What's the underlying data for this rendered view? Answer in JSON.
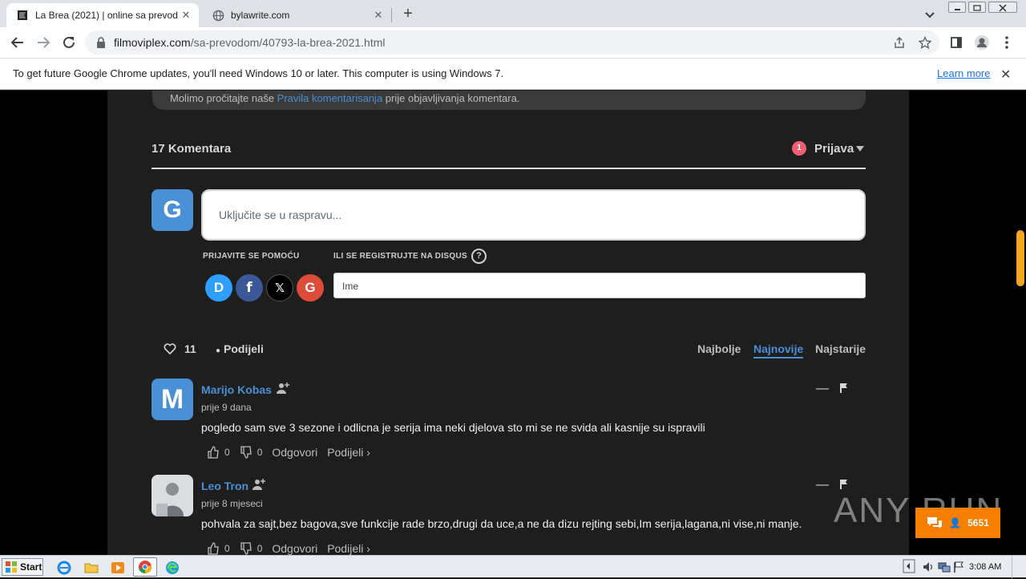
{
  "browser": {
    "tabs": [
      {
        "title": "La Brea (2021) | online sa prevodom",
        "active": true
      },
      {
        "title": "bylawrite.com",
        "active": false
      }
    ],
    "url_domain": "filmoviplex.com",
    "url_path": "/sa-prevodom/40793-la-brea-2021.html",
    "infobar_message": "To get future Google Chrome updates, you'll need Windows 10 or later. This computer is using Windows 7.",
    "infobar_link": "Learn more"
  },
  "page": {
    "rules_text_before": "Molimo pročitajte naše ",
    "rules_link": "Pravila komentarisanja",
    "rules_text_after": " prije objavljivanja komentara.",
    "comment_count": "17 Komentara",
    "notification_count": "1",
    "login_label": "Prijava",
    "guest_avatar_letter": "G",
    "reply_placeholder": "Uključite se u raspravu...",
    "login_with_label": "PRIJAVITE SE POMOĆU",
    "register_label": "ILI SE REGISTRUJTE NA DISQUS",
    "help_glyph": "?",
    "name_placeholder": "Ime",
    "social": [
      {
        "name": "disqus",
        "letter": "D",
        "color": "#2e9fff"
      },
      {
        "name": "facebook",
        "letter": "f",
        "color": "#3b5998"
      },
      {
        "name": "x",
        "letter": "𝕏",
        "color": "#000000"
      },
      {
        "name": "google",
        "letter": "G",
        "color": "#dd4b39"
      }
    ],
    "votes_count": "11",
    "share_label": "Podijeli",
    "sort_options": [
      "Najbolje",
      "Najnovije",
      "Najstarije"
    ],
    "active_sort": "Najnovije"
  },
  "comments": [
    {
      "author": "Marijo Kobas",
      "avatar_letter": "M",
      "time": "prije 9 dana",
      "text": "pogledo sam sve 3 sezone i odlicna je serija ima neki djelova sto mi se ne svida ali kasnije su ispravili",
      "upvotes": "0",
      "downvotes": "0",
      "reply_label": "Odgovori",
      "share_label": "Podijeli ›"
    },
    {
      "author": "Leo Tron",
      "avatar_letter": "",
      "time": "prije 8 mjeseci",
      "text": "pohvala za sajt,bez bagova,sve funkcije rade brzo,drugi da uce,a ne da dizu rejting sebi,Im serija,lagana,ni vise,ni manje.",
      "upvotes": "0",
      "downvotes": "0",
      "reply_label": "Odgovori",
      "share_label": "Podijeli ›"
    }
  ],
  "chat_widget": {
    "count": "5651"
  },
  "watermark": "ANY RUN",
  "taskbar": {
    "start_label": "Start",
    "clock": "3:08 AM"
  },
  "colors": {
    "accent": "#4a8fd6",
    "page_bg": "#1e1e1e",
    "notif": "#f05f70",
    "chat": "#f77f00"
  }
}
